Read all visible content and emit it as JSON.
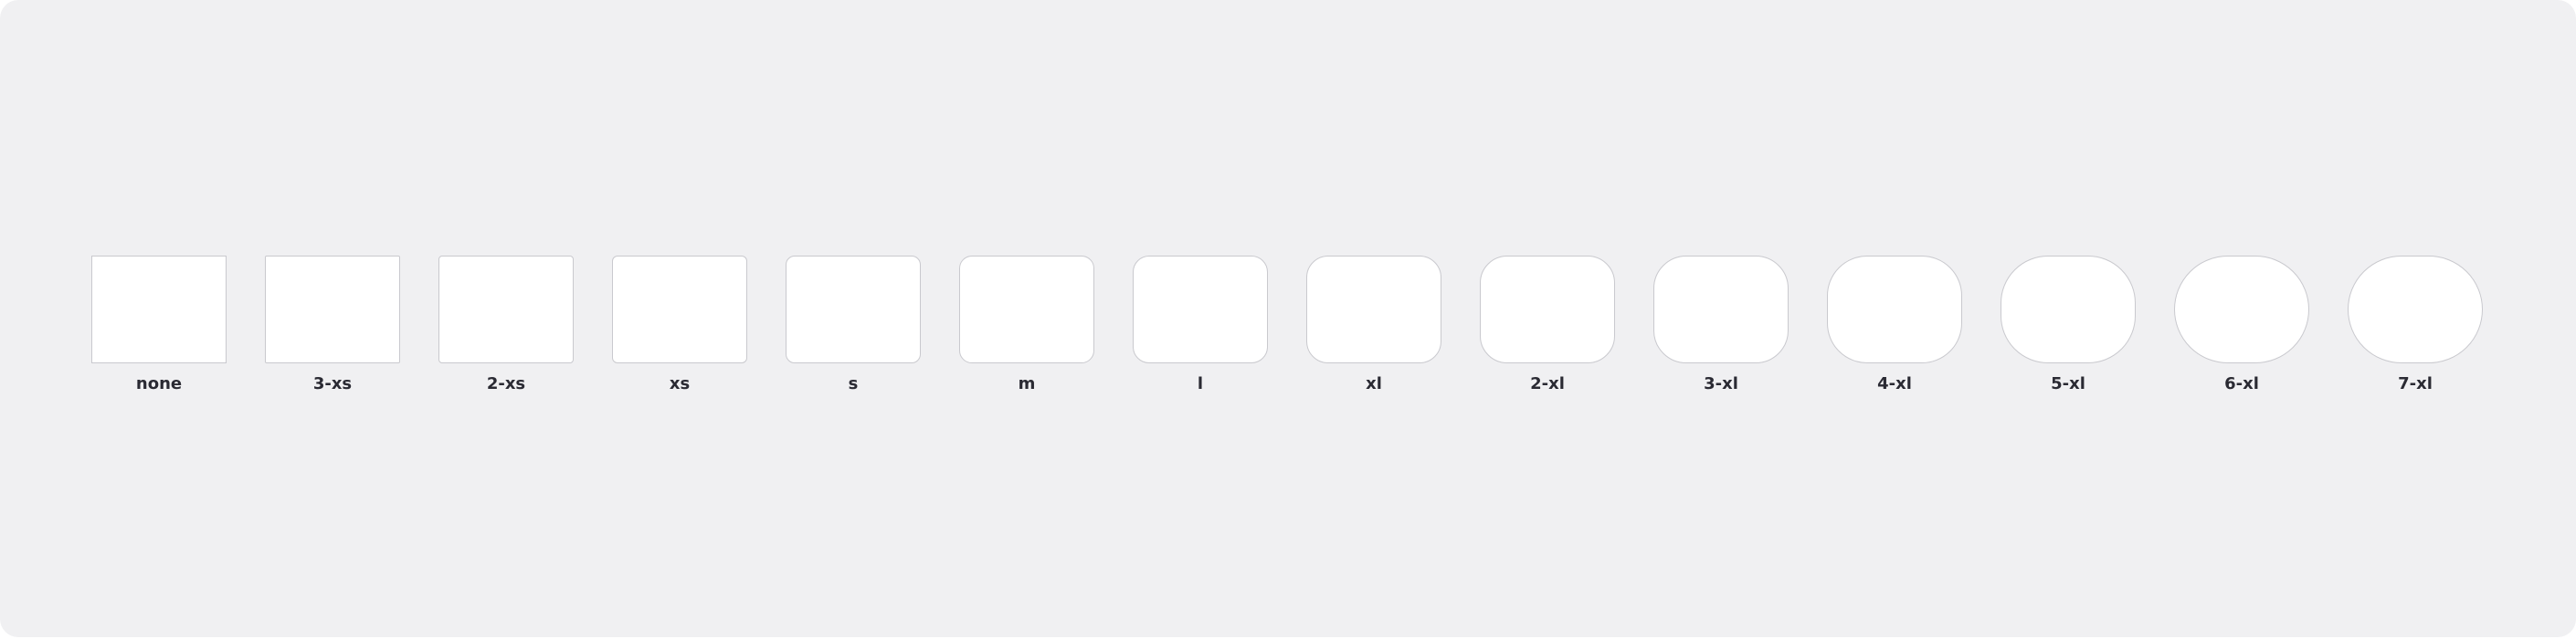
{
  "radius_scale": {
    "items": [
      {
        "label": "none"
      },
      {
        "label": "3-xs"
      },
      {
        "label": "2-xs"
      },
      {
        "label": "xs"
      },
      {
        "label": "s"
      },
      {
        "label": "m"
      },
      {
        "label": "l"
      },
      {
        "label": "xl"
      },
      {
        "label": "2-xl"
      },
      {
        "label": "3-xl"
      },
      {
        "label": "4-xl"
      },
      {
        "label": "5-xl"
      },
      {
        "label": "6-xl"
      },
      {
        "label": "7-xl"
      }
    ]
  }
}
